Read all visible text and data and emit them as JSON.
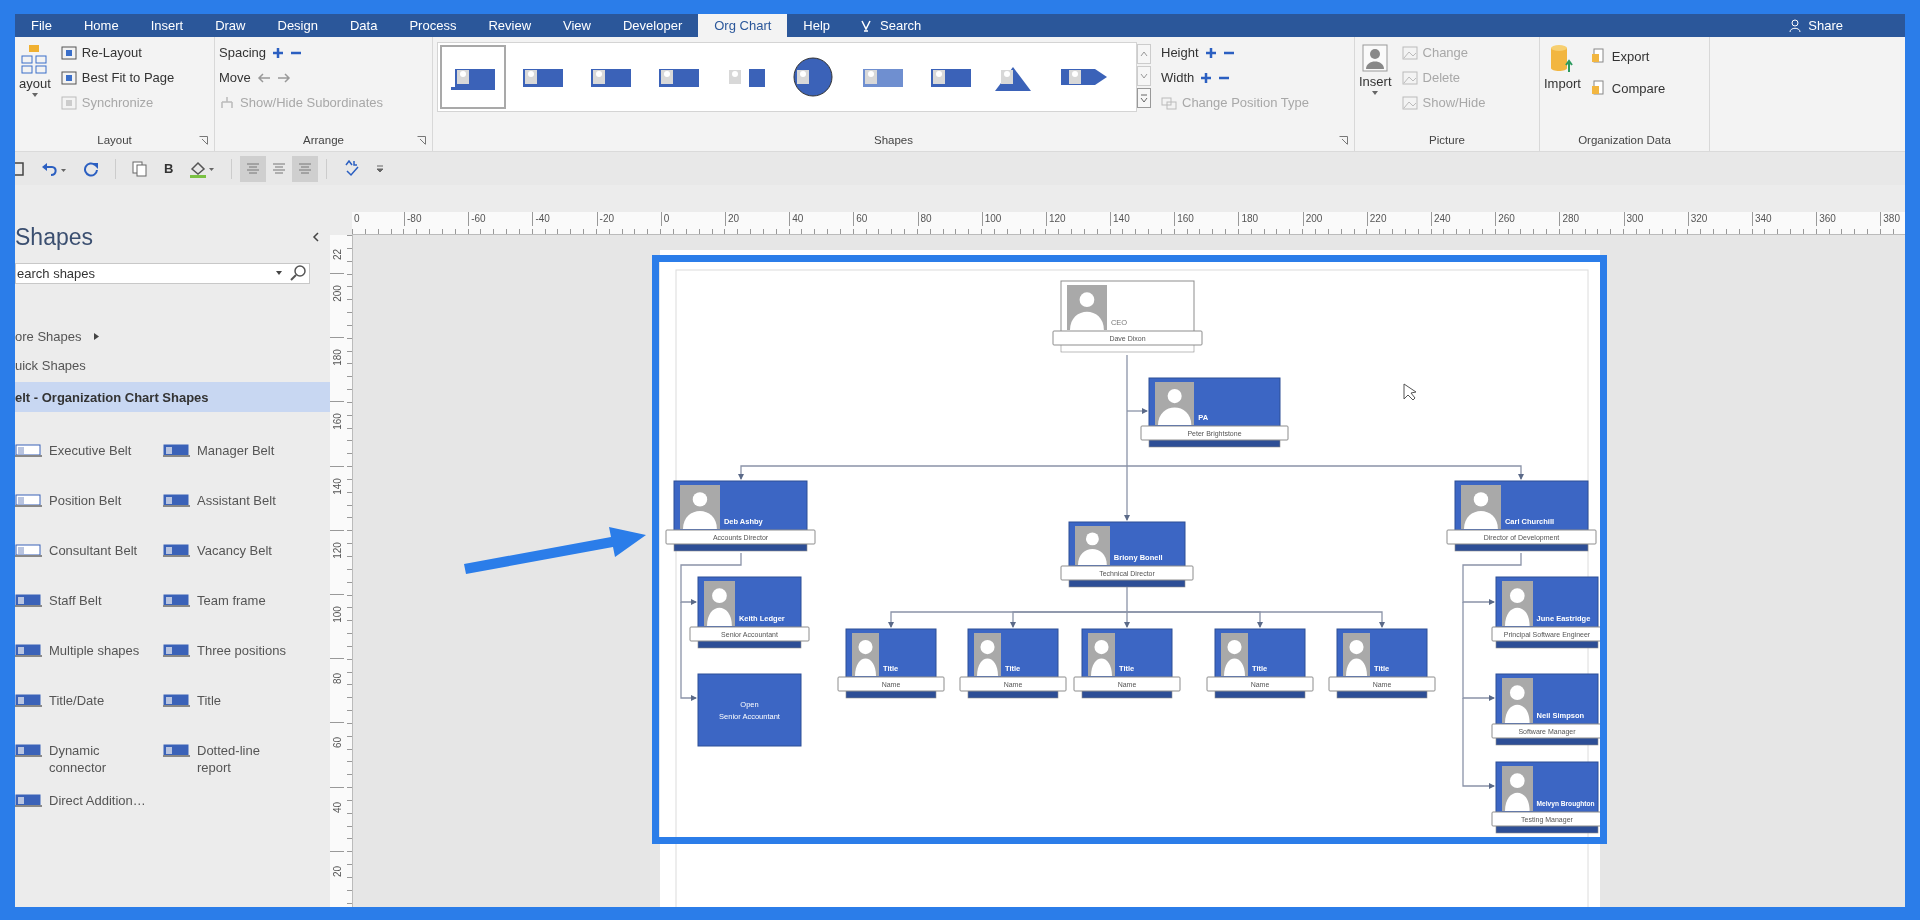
{
  "tabs": [
    {
      "label": "File",
      "selected": false
    },
    {
      "label": "Home",
      "selected": false
    },
    {
      "label": "Insert",
      "selected": false
    },
    {
      "label": "Draw",
      "selected": false
    },
    {
      "label": "Design",
      "selected": false
    },
    {
      "label": "Data",
      "selected": false
    },
    {
      "label": "Process",
      "selected": false
    },
    {
      "label": "Review",
      "selected": false
    },
    {
      "label": "View",
      "selected": false
    },
    {
      "label": "Developer",
      "selected": false
    },
    {
      "label": "Org Chart",
      "selected": true
    },
    {
      "label": "Help",
      "selected": false
    }
  ],
  "tell_me": "Search",
  "share": "Share",
  "ribbon": {
    "layout": {
      "label": "Layout",
      "large_button": "ayout",
      "buttons": [
        {
          "label": "Re-Layout",
          "disabled": false
        },
        {
          "label": "Best Fit to Page",
          "disabled": false
        },
        {
          "label": "Synchronize",
          "disabled": true
        }
      ]
    },
    "arrange": {
      "label": "Arrange",
      "rows": [
        {
          "label": "Spacing",
          "disabled": false
        },
        {
          "label": "Move",
          "disabled": false
        }
      ],
      "button": {
        "label": "Show/Hide Subordinates",
        "disabled": true
      }
    },
    "shapes": {
      "label": "Shapes",
      "gallery": [
        {
          "selected": true
        },
        {
          "selected": false
        },
        {
          "selected": false
        },
        {
          "selected": false
        },
        {
          "selected": false
        },
        {
          "selected": false
        },
        {
          "selected": false
        },
        {
          "selected": false
        },
        {
          "selected": false
        },
        {
          "selected": false
        }
      ],
      "rows": [
        {
          "label": "Height",
          "disabled": false
        },
        {
          "label": "Width",
          "disabled": false
        }
      ],
      "button": {
        "label": "Change Position Type",
        "disabled": true
      }
    },
    "picture": {
      "label": "Picture",
      "large_button": "Insert",
      "buttons": [
        {
          "label": "Change",
          "disabled": true
        },
        {
          "label": "Delete",
          "disabled": true
        },
        {
          "label": "Show/Hide",
          "disabled": true
        }
      ]
    },
    "org_data": {
      "label": "Organization Data",
      "large_button": "Import",
      "buttons": [
        {
          "label": "Export",
          "disabled": false
        },
        {
          "label": "Compare",
          "disabled": false
        }
      ]
    }
  },
  "quick_access": {
    "bold": "B",
    "align": [
      {
        "selected": true
      },
      {
        "selected": false
      },
      {
        "selected": true
      }
    ]
  },
  "shapes_panel": {
    "title": "Shapes",
    "search": {
      "placeholder": "earch shapes"
    },
    "nav": [
      {
        "label": "ore Shapes",
        "kind": "menu",
        "selected": false
      },
      {
        "label": "uick Shapes",
        "kind": "stencil",
        "selected": false
      },
      {
        "label": "elt - Organization Chart Shapes",
        "kind": "stencil",
        "selected": true
      }
    ],
    "items": [
      "Executive Belt",
      "Manager Belt",
      "Position Belt",
      "Assistant Belt",
      "Consultant Belt",
      "Vacancy Belt",
      "Staff Belt",
      "Team frame",
      "Multiple shapes",
      "Three positions",
      "Title/Date",
      "Title",
      "Dynamic connector",
      "Dotted-line report",
      "Direct Addition…"
    ]
  },
  "rulers": {
    "horizontal": [
      "0",
      "-80",
      "-60",
      "-40",
      "-20",
      "0",
      "20",
      "40",
      "60",
      "80",
      "100",
      "120",
      "140",
      "160",
      "180",
      "200",
      "220",
      "240",
      "260",
      "280",
      "300",
      "320",
      "340",
      "360",
      "380"
    ],
    "vertical": [
      "22",
      "200",
      "180",
      "160",
      "140",
      "120",
      "100",
      "80",
      "60",
      "40",
      "20"
    ]
  },
  "org_chart": {
    "nodes": [
      {
        "kind": "executive",
        "label": "CEO",
        "caption": "Dave Dixon"
      },
      {
        "kind": "belt",
        "label": "PA",
        "caption": "Peter Brightstone"
      },
      {
        "kind": "belt",
        "label": "Deb Ashby",
        "caption": "Accounts Director"
      },
      {
        "kind": "belt",
        "label": "Briony Bonell",
        "caption": "Technical Director"
      },
      {
        "kind": "belt",
        "label": "Carl Churchill",
        "caption": "Director of Development"
      },
      {
        "kind": "belt",
        "label": "Keith Ledger",
        "caption": "Senior Accountant"
      },
      {
        "kind": "vacancy",
        "label": "Open",
        "caption": "Senior Accountant"
      },
      {
        "kind": "belt",
        "label": "Title",
        "caption": "Name"
      },
      {
        "kind": "belt",
        "label": "Title",
        "caption": "Name"
      },
      {
        "kind": "belt",
        "label": "Title",
        "caption": "Name"
      },
      {
        "kind": "belt",
        "label": "Title",
        "caption": "Name"
      },
      {
        "kind": "belt",
        "label": "Title",
        "caption": "Name"
      },
      {
        "kind": "belt",
        "label": "June Eastridge",
        "caption": "Principal Software Engineer"
      },
      {
        "kind": "belt",
        "label": "Neil Simpson",
        "caption": "Software Manager"
      },
      {
        "kind": "belt",
        "label": "Melvyn Broughton",
        "caption": "Testing Manager"
      }
    ]
  }
}
